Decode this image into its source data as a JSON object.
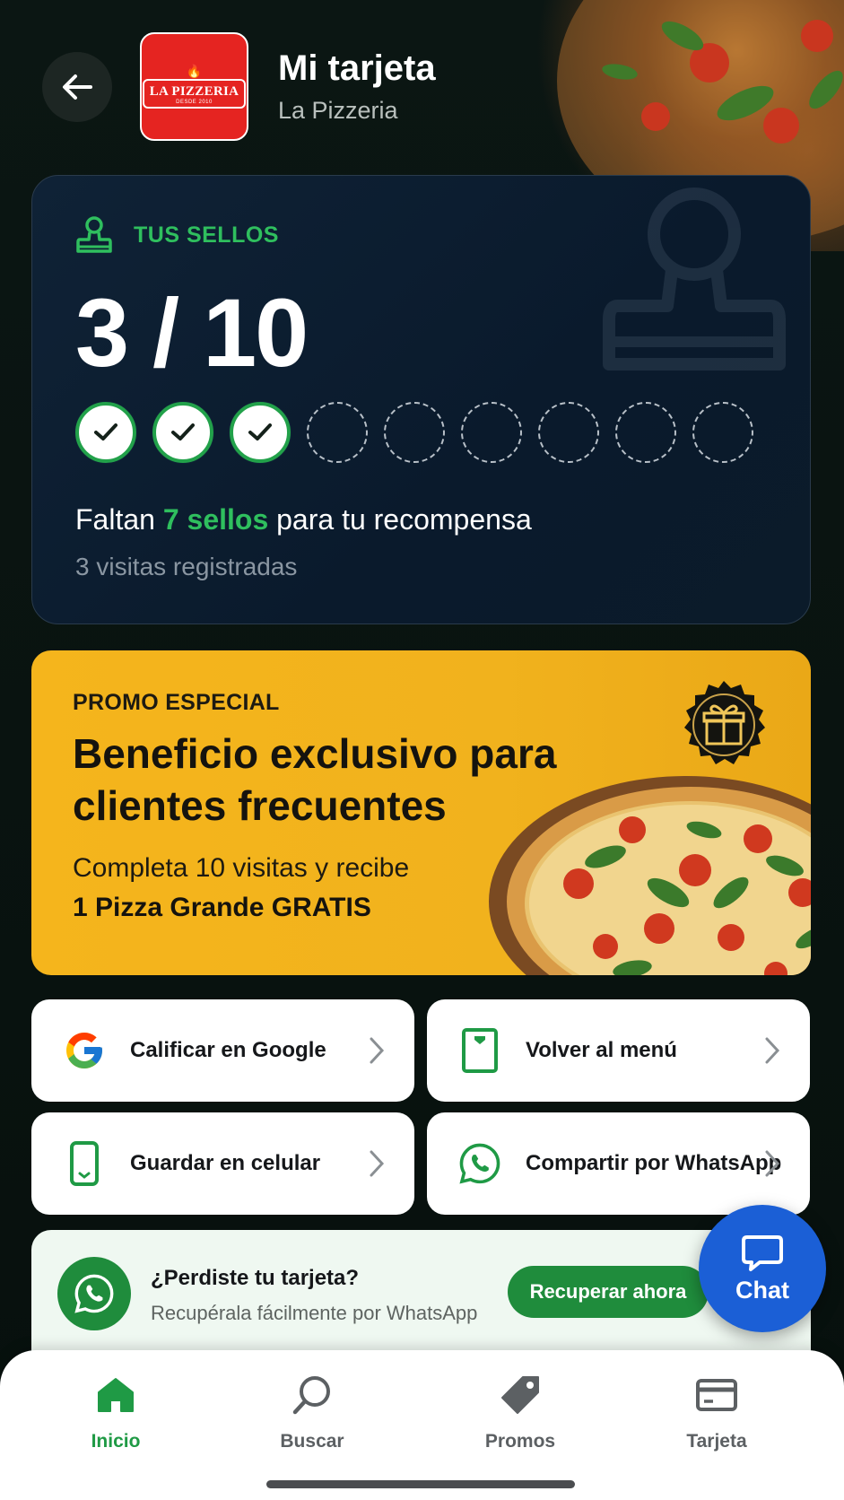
{
  "header": {
    "title": "Mi tarjeta",
    "subtitle": "La Pizzeria",
    "logo_text": "LA PIZZERIA",
    "logo_tagline": "DESDE 2010"
  },
  "stamps": {
    "label": "TUS SELLOS",
    "count_text": "3 / 10",
    "collected": 3,
    "total": 10,
    "faltan_prefix": "Faltan",
    "faltan_highlight": "7 sellos",
    "faltan_suffix": "para tu recompensa",
    "visits_text": "3 visitas registradas"
  },
  "promo": {
    "eyebrow": "PROMO ESPECIAL",
    "title": "Beneficio exclusivo para clientes frecuentes",
    "description": "Completa 10 visitas y recibe",
    "reward": "1 Pizza Grande GRATIS"
  },
  "actions": [
    {
      "label": "Calificar en Google",
      "icon": "google-icon"
    },
    {
      "label": "Volver al menú",
      "icon": "menu-card-icon"
    },
    {
      "label": "Guardar en celular",
      "icon": "phone-icon"
    },
    {
      "label": "Compartir por WhatsApp",
      "icon": "whatsapp-icon"
    }
  ],
  "recover": {
    "title": "¿Perdiste tu tarjeta?",
    "subtitle": "Recupérala fácilmente por WhatsApp",
    "button": "Recuperar ahora"
  },
  "chat": {
    "label": "Chat"
  },
  "nav": [
    {
      "label": "Inicio",
      "icon": "home-icon",
      "active": true
    },
    {
      "label": "Buscar",
      "icon": "search-icon",
      "active": false
    },
    {
      "label": "Promos",
      "icon": "tag-icon",
      "active": false
    },
    {
      "label": "Tarjeta",
      "icon": "card-icon",
      "active": false
    }
  ],
  "colors": {
    "accent_green": "#2fbf5e",
    "promo_yellow": "#f5b51c",
    "chat_blue": "#1b5fd6",
    "logo_red": "#e52421"
  }
}
